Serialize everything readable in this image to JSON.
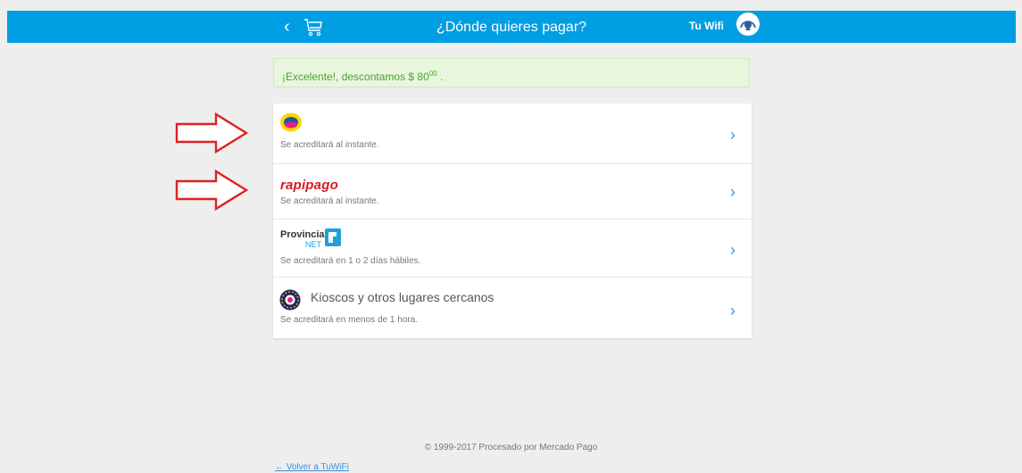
{
  "header": {
    "title": "¿Dónde quieres pagar?",
    "brand_name": "Tu Wifi",
    "back_icon": "chevron-left-icon",
    "cart_icon": "cart-icon",
    "background": "#009ee3"
  },
  "alert": {
    "text": "¡Excelente!, descontamos $ 80",
    "cents": "00",
    "trailing": ".",
    "color": "#45a72a"
  },
  "options": [
    {
      "logo": "pagofacil-logo",
      "description": "Se acreditará al instante."
    },
    {
      "logo_text": "rapipago",
      "description": "Se acreditará al instante."
    },
    {
      "logo_text": "Provincia",
      "logo_sub": "NET",
      "description": "Se acreditará en 1 o 2 días hábiles."
    },
    {
      "logo": "cargavirtual-logo",
      "title": "Kioscos y otros lugares cercanos",
      "description": "Se acreditará en menos de 1 hora."
    }
  ],
  "footer": {
    "copyright": "© 1999-2017 Procesado por Mercado Pago",
    "back_link": "← Volver a TuWiFi"
  },
  "annotation_color": "#e02020"
}
